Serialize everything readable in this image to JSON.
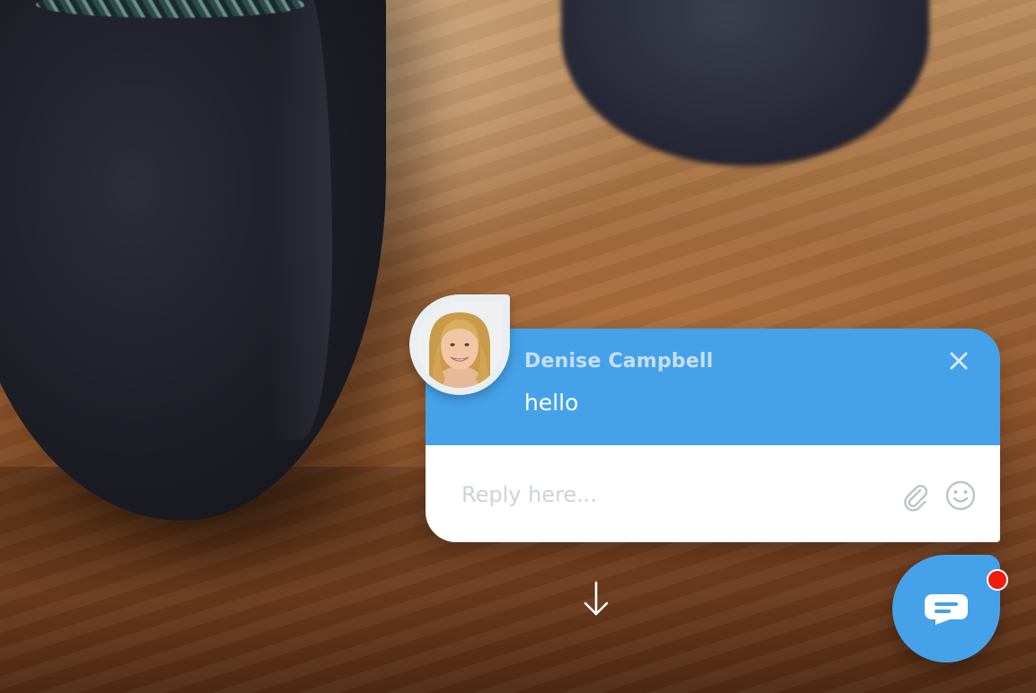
{
  "chat_card": {
    "sender_name": "Denise Campbell",
    "message": "hello",
    "close_icon": "close-icon",
    "reply_placeholder": "Reply here...",
    "reply_value": "",
    "attach_icon": "paperclip-icon",
    "emoji_icon": "smiley-icon"
  },
  "scroll_icon": "arrow-down-icon",
  "launcher": {
    "icon": "chat-bubble-icon",
    "has_notification": true
  },
  "colors": {
    "accent": "#45a2e8",
    "sender_name": "#c8def4",
    "notification": "#f21b0f",
    "placeholder": "#cfd3d8"
  }
}
